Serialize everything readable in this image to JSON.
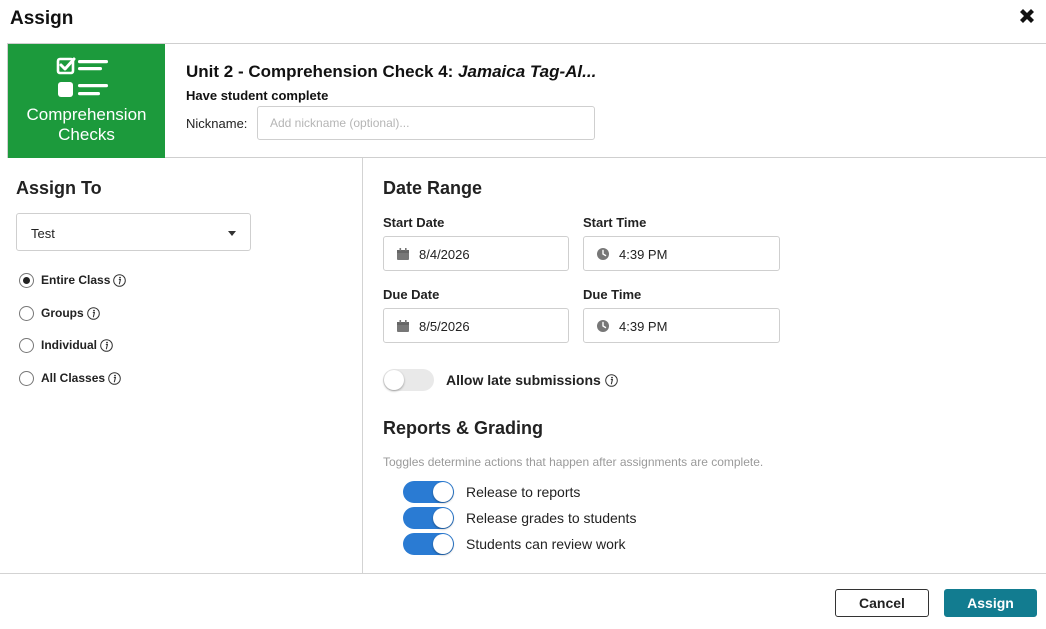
{
  "dialog": {
    "title": "Assign",
    "close_icon": "close-x-icon"
  },
  "header": {
    "logo": {
      "line1": "Comprehension",
      "line2": "Checks",
      "color": "#1c9a3c",
      "icon": "checklist-icon"
    },
    "unit_title": "Unit 2 - Comprehension Check 4: ",
    "unit_title_italic": "Jamaica Tag-Al...",
    "have_student": "Have student complete",
    "nickname_label": "Nickname:",
    "nickname_value": "",
    "nickname_placeholder": "Add nickname (optional)..."
  },
  "assign_to": {
    "title": "Assign To",
    "class_select": "Test",
    "options": [
      {
        "label": "Entire Class",
        "checked": true
      },
      {
        "label": "Groups",
        "checked": false
      },
      {
        "label": "Individual",
        "checked": false
      },
      {
        "label": "All Classes",
        "checked": false
      }
    ]
  },
  "date_range": {
    "title": "Date Range",
    "start_date_label": "Start Date",
    "start_date": "8/4/2026",
    "start_time_label": "Start Time",
    "start_time": "4:39 PM",
    "due_date_label": "Due Date",
    "due_date": "8/5/2026",
    "due_time_label": "Due Time",
    "due_time": "4:39 PM",
    "late_label": "Allow late submissions",
    "late_enabled": false
  },
  "reports": {
    "title": "Reports & Grading",
    "hint": "Toggles determine actions that happen after assignments are complete.",
    "toggles": [
      {
        "label": "Release to reports",
        "on": true
      },
      {
        "label": "Release grades to students",
        "on": true
      },
      {
        "label": "Students can review work",
        "on": true
      }
    ],
    "accent": "#2a7bd3"
  },
  "footer": {
    "cancel": "Cancel",
    "assign": "Assign",
    "assign_color": "#127c90"
  }
}
